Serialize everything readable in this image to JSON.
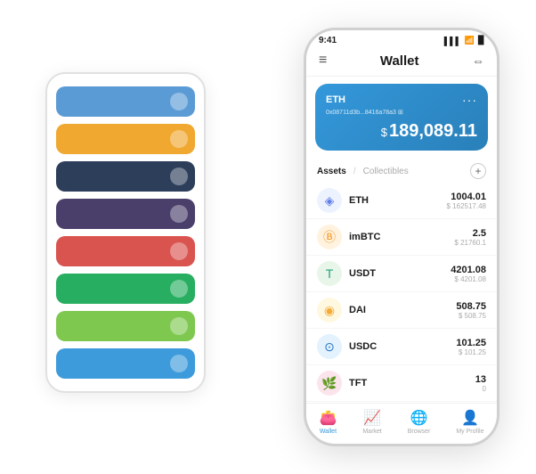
{
  "bg_card": {
    "bars": [
      {
        "color": "#5b9bd5",
        "id": "blue1"
      },
      {
        "color": "#f0a830",
        "id": "orange"
      },
      {
        "color": "#2c3e5a",
        "id": "darkblue"
      },
      {
        "color": "#4a3f6b",
        "id": "purple"
      },
      {
        "color": "#d9534f",
        "id": "red"
      },
      {
        "color": "#27ae60",
        "id": "green1"
      },
      {
        "color": "#7ec850",
        "id": "lightgreen"
      },
      {
        "color": "#3d9bdb",
        "id": "blue2"
      }
    ]
  },
  "status_bar": {
    "time": "9:41",
    "signal": "▌▌▌",
    "wifi": "WiFi",
    "battery": "🔋"
  },
  "header": {
    "menu_icon": "≡",
    "title": "Wallet",
    "expand_icon": "⇔"
  },
  "eth_card": {
    "label": "ETH",
    "dots": "···",
    "address": "0x08711d3b...8416a78a3 ⊞",
    "currency": "$",
    "amount": "189,089.11"
  },
  "assets_header": {
    "tab_active": "Assets",
    "divider": "/",
    "tab_inactive": "Collectibles",
    "add_icon": "+"
  },
  "assets": [
    {
      "symbol": "ETH",
      "icon": "◈",
      "icon_color": "#627eea",
      "amount": "1004.01",
      "usd": "$ 162517.48"
    },
    {
      "symbol": "imBTC",
      "icon": "Ⓑ",
      "icon_color": "#f7931a",
      "amount": "2.5",
      "usd": "$ 21760.1"
    },
    {
      "symbol": "USDT",
      "icon": "T",
      "icon_color": "#26a17b",
      "amount": "4201.08",
      "usd": "$ 4201.08"
    },
    {
      "symbol": "DAI",
      "icon": "◉",
      "icon_color": "#f5ac37",
      "amount": "508.75",
      "usd": "$ 508.75"
    },
    {
      "symbol": "USDC",
      "icon": "⊙",
      "icon_color": "#2775ca",
      "amount": "101.25",
      "usd": "$ 101.25"
    },
    {
      "symbol": "TFT",
      "icon": "🌿",
      "icon_color": "#e91e8c",
      "amount": "13",
      "usd": "0"
    }
  ],
  "bottom_nav": [
    {
      "icon": "👛",
      "label": "Wallet",
      "active": true
    },
    {
      "icon": "📈",
      "label": "Market",
      "active": false
    },
    {
      "icon": "🌐",
      "label": "Browser",
      "active": false
    },
    {
      "icon": "👤",
      "label": "My Profile",
      "active": false
    }
  ]
}
